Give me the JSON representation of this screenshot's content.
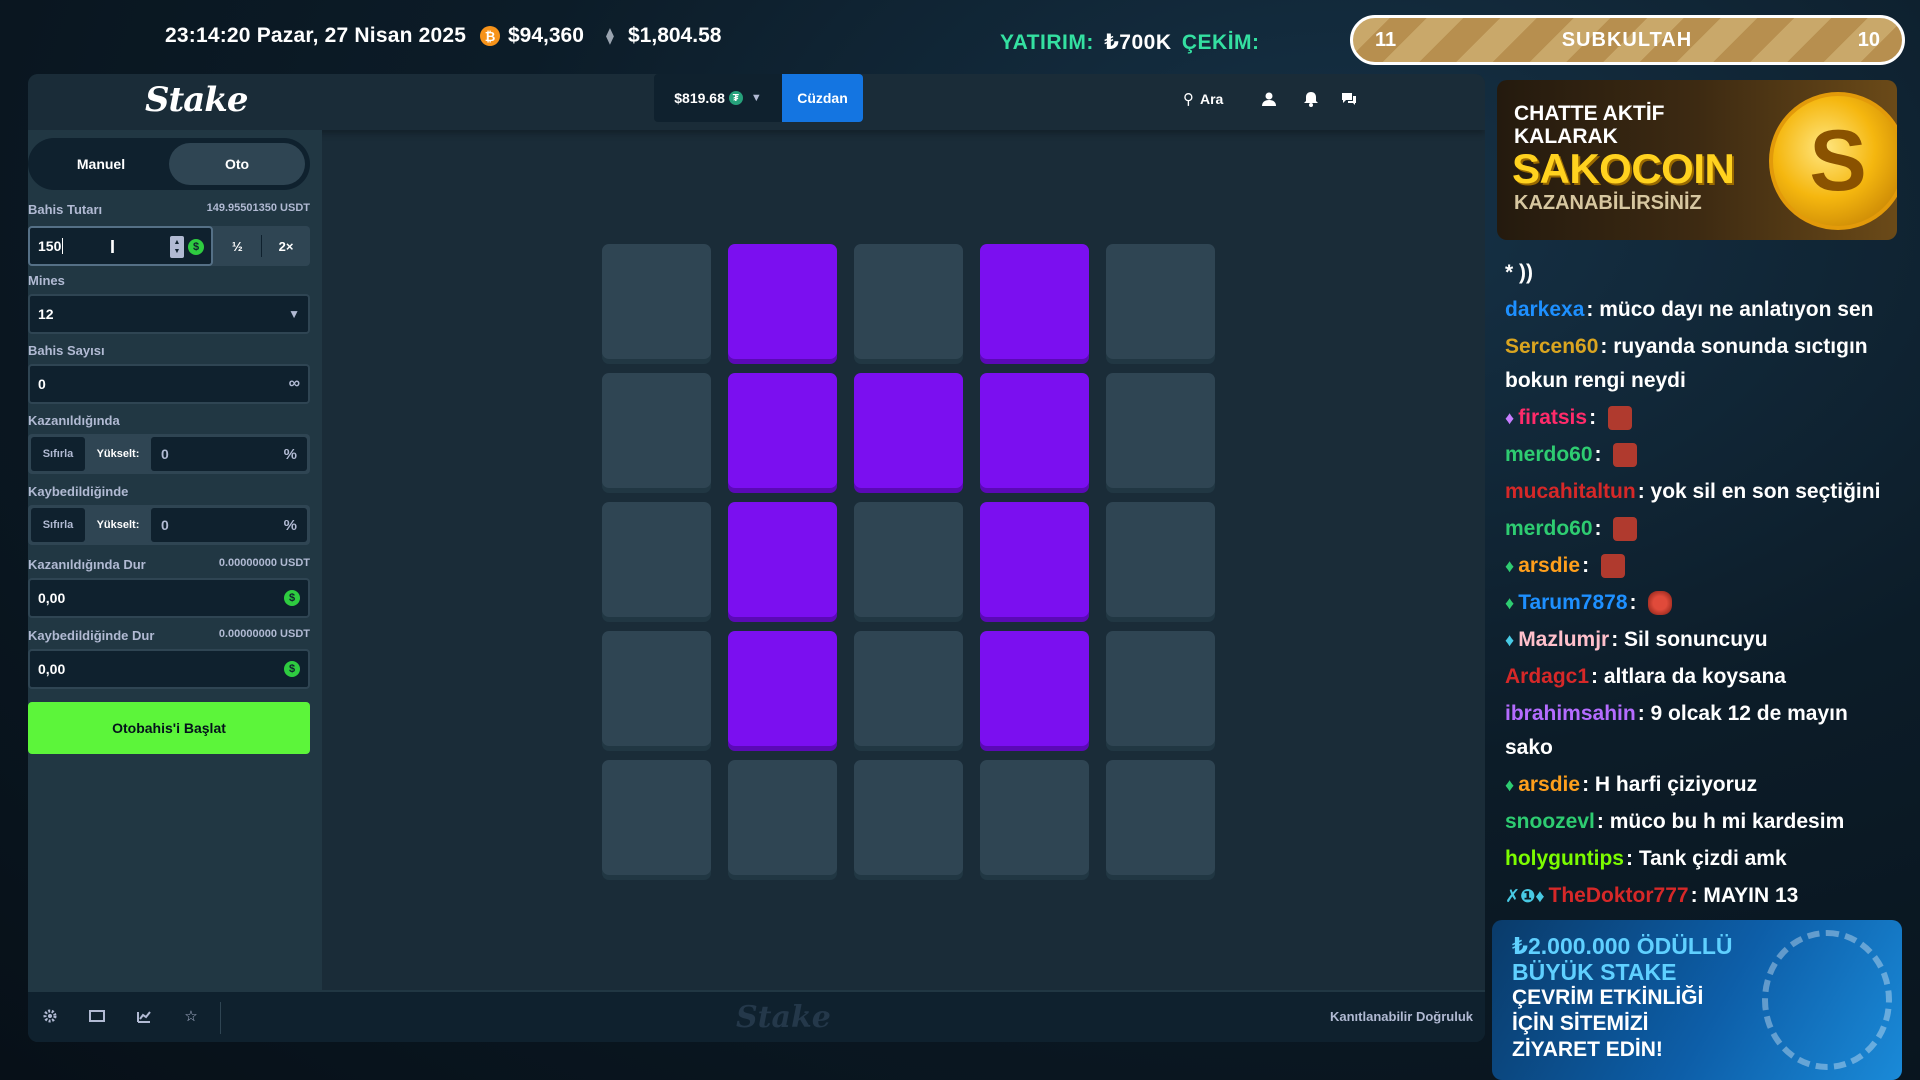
{
  "overlay": {
    "datetime": "23:14:20 Pazar, 27 Nisan 2025",
    "btc_price": "$94,360",
    "eth_price": "$1,804.58",
    "btc_symbol": "₿",
    "eth_symbol": "⧫",
    "deposit_label": "YATIRIM:",
    "deposit_amount": "₺700K",
    "withdraw_label": "ÇEKİM:",
    "sub_left": "11",
    "sub_label": "SUBKULTAH",
    "sub_right": "10"
  },
  "header": {
    "logo": "Stake",
    "balance": "$819.68",
    "balance_coin": "₮",
    "wallet_label": "Cüzdan",
    "search_label": "Ara"
  },
  "sidebar": {
    "tab_manual": "Manuel",
    "tab_auto": "Oto",
    "bet_amount_label": "Bahis Tutarı",
    "bet_amount_usdt": "149.95501350 USDT",
    "bet_amount_value": "150",
    "half_label": "½",
    "double_label": "2×",
    "mines_label": "Mines",
    "mines_value": "12",
    "bet_count_label": "Bahis Sayısı",
    "bet_count_value": "0",
    "on_win_label": "Kazanıldığında",
    "on_loss_label": "Kaybedildiğinde",
    "reset_label": "Sıfırla",
    "raise_label": "Yükselt:",
    "on_win_value": "0",
    "on_loss_value": "0",
    "percent_symbol": "%",
    "stop_win_label": "Kazanıldığında Dur",
    "stop_win_usdt": "0.00000000 USDT",
    "stop_win_value": "0,00",
    "stop_loss_label": "Kaybedildiğinde Dur",
    "stop_loss_usdt": "0.00000000 USDT",
    "stop_loss_value": "0,00",
    "start_button": "Otobahis'i Başlat"
  },
  "board": {
    "rows": 5,
    "cols": 5,
    "gem_color": "#7b0ff0",
    "hidden_color": "#2f4553",
    "tiles": [
      [
        "hidden",
        "gem",
        "hidden",
        "gem",
        "hidden"
      ],
      [
        "hidden",
        "gem",
        "gem",
        "gem",
        "hidden"
      ],
      [
        "hidden",
        "gem",
        "hidden",
        "gem",
        "hidden"
      ],
      [
        "hidden",
        "gem",
        "hidden",
        "gem",
        "hidden"
      ],
      [
        "hidden",
        "hidden",
        "hidden",
        "hidden",
        "hidden"
      ]
    ]
  },
  "footer": {
    "logo": "Stake",
    "fairness_label": "Kanıtlanabilir Doğruluk",
    "icons": [
      "settings-icon",
      "theatre-mode-icon",
      "stats-icon",
      "favorite-icon"
    ]
  },
  "promo_top": {
    "line1a": "CHATTE AKTİF",
    "line1b": "KALARAK",
    "brand": "SAKOCOIN",
    "line3": "KAZANABİLİRSİNİZ"
  },
  "chat": {
    "first_fragment": "* ))",
    "messages": [
      {
        "user": "darkexa",
        "color": "#1e90ff",
        "text": "müco dayı ne anlatıyon sen"
      },
      {
        "user": "Sercen60",
        "color": "#daa520",
        "text": "ruyanda sonunda sıctıgın bokun rengi neydi"
      },
      {
        "user": "firatsis",
        "color": "#ff2b6a",
        "text": "",
        "badge": "♦",
        "badge_color": "#c77dff",
        "emote": true
      },
      {
        "user": "merdo60",
        "color": "#2ecc71",
        "text": "",
        "emote": true
      },
      {
        "user": "mucahitaltun",
        "color": "#d62828",
        "text": "yok sil en son seçtiğini"
      },
      {
        "user": "merdo60",
        "color": "#2ecc71",
        "text": "",
        "emote": true
      },
      {
        "user": "arsdie",
        "color": "#ff9f1c",
        "text": "",
        "badge": "♦",
        "badge_color": "#2ecc71",
        "emote": true
      },
      {
        "user": "Tarum7878",
        "color": "#1e90ff",
        "text": "",
        "badge": "♦",
        "badge_color": "#2ecc71",
        "emote": true,
        "mask": true
      },
      {
        "user": "Mazlumjr",
        "color": "#ffc0cb",
        "text": "Sil sonuncuyu",
        "badge": "♦",
        "badge_color": "#48cae4"
      },
      {
        "user": "Ardagc1",
        "color": "#d62828",
        "text": "altlara da koysana"
      },
      {
        "user": "ibrahimsahin",
        "color": "#b56cff",
        "text": "9 olcak 12 de mayın sako"
      },
      {
        "user": "arsdie",
        "color": "#ff9f1c",
        "text": "H harfi çiziyoruz",
        "badge": "♦",
        "badge_color": "#2ecc71"
      },
      {
        "user": "snoozevl",
        "color": "#2ecc71",
        "text": "müco bu h mi kardesim"
      },
      {
        "user": "holyguntips",
        "color": "#7CFC00",
        "text": "Tank çizdi amk"
      },
      {
        "user": "TheDoktor777",
        "color": "#d62828",
        "text": "MAYIN 13",
        "badge": "✗❶♦",
        "badge_color": "#48cae4"
      }
    ]
  },
  "promo_bottom": {
    "amount1": "₺2.000.000 ÖDÜLLÜ",
    "amount2": "BÜYÜK STAKE",
    "line1": "ÇEVRİM ETKİNLİĞİ",
    "line2": "İÇİN SİTEMİZİ",
    "line3": "ZİYARET EDİN!"
  }
}
